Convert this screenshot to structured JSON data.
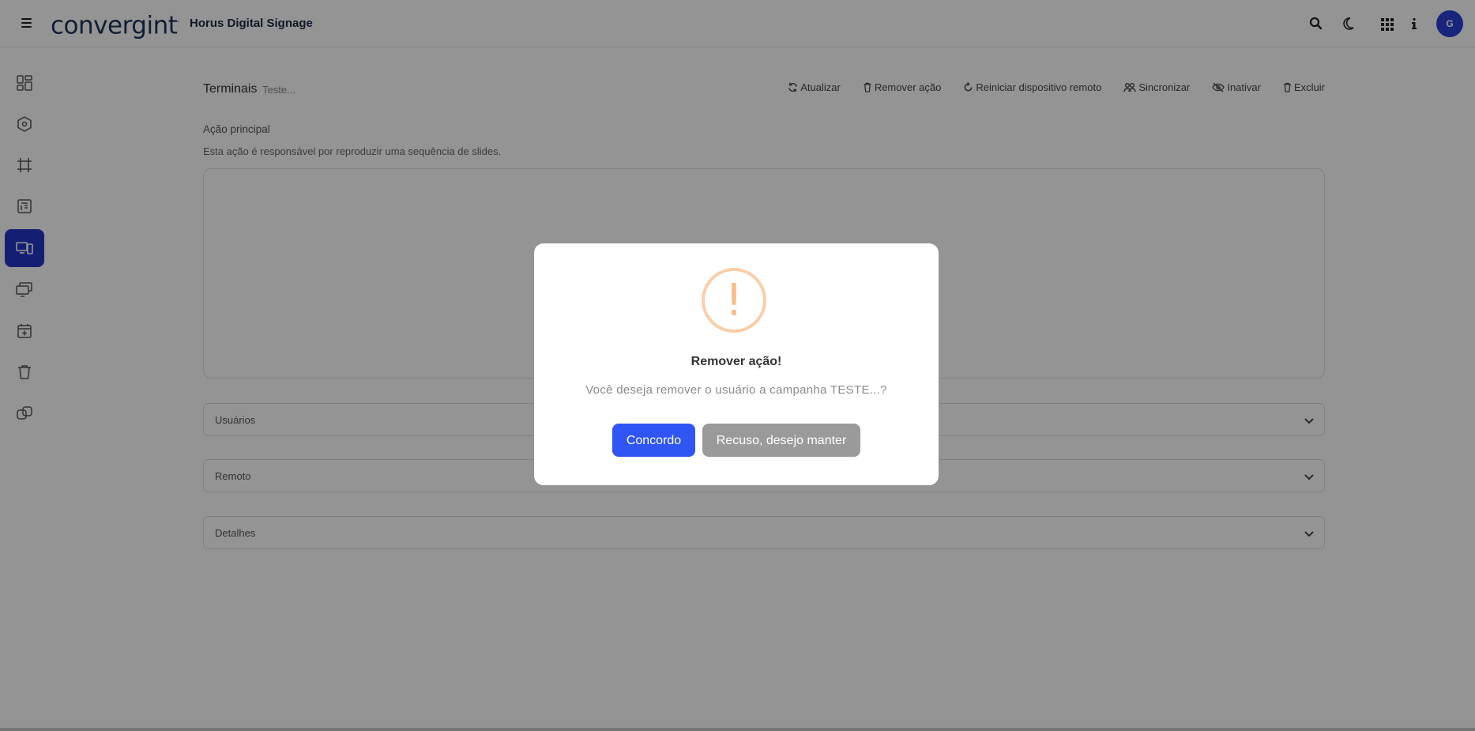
{
  "topbar": {
    "logo": "convergint",
    "app_title": "Horus Digital Signage",
    "avatar_initial": "G",
    "icons": [
      "menu-icon",
      "search-icon",
      "moon-icon",
      "apps-grid-icon",
      "info-icon"
    ]
  },
  "sidebar": {
    "items": [
      {
        "icon": "dashboard-icon",
        "active": false
      },
      {
        "icon": "network-icon",
        "active": false
      },
      {
        "icon": "frame-icon",
        "active": false
      },
      {
        "icon": "document-icon",
        "active": false
      },
      {
        "icon": "devices-icon",
        "active": true
      },
      {
        "icon": "monitors-icon",
        "active": false
      },
      {
        "icon": "calendar-add-icon",
        "active": false
      },
      {
        "icon": "trash-icon",
        "active": false
      },
      {
        "icon": "link-icon",
        "active": false
      }
    ]
  },
  "main": {
    "section_title": "Terminais",
    "section_subtitle": "Teste...",
    "actions": {
      "refresh": "Atualizar",
      "remove_action": "Remover ação",
      "restart_remote": "Reiniciar dispositivo remoto",
      "sync": "Sincronizar",
      "deactivate": "Inativar",
      "delete": "Excluir"
    },
    "primary_action_label": "Ação principal",
    "primary_action_description": "Esta ação é responsável por reproduzir uma sequência de slides.",
    "accordions": {
      "users": "Usuários",
      "remote": "Remoto",
      "details": "Detalhes"
    }
  },
  "modal": {
    "icon_glyph": "!",
    "title": "Remover ação!",
    "message": "Você deseja remover o usuário a campanha TESTE...?",
    "confirm_label": "Concordo",
    "cancel_label": "Recuso, desejo manter",
    "colors": {
      "confirm": "#2f55f5",
      "cancel": "#9a9a9a",
      "warning": "#f8bb86"
    }
  }
}
